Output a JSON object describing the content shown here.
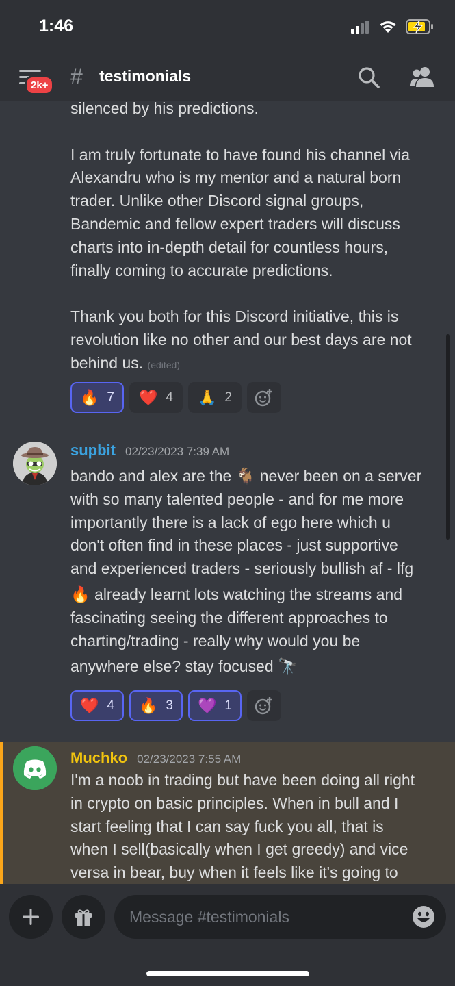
{
  "status_bar": {
    "time": "1:46"
  },
  "header": {
    "badge": "2k+",
    "hash": "#",
    "channel": "testimonials"
  },
  "messages": [
    {
      "continuation_lines": [
        "silenced by his predictions.",
        "",
        "I am truly fortunate to have found his channel via",
        "Alexandru who is my mentor and a natural born",
        "trader. Unlike other Discord signal groups,",
        "Bandemic and fellow expert traders will discuss",
        "charts into in-depth detail for countless hours,",
        "finally coming to accurate predictions.",
        "",
        "Thank you both for this Discord initiative, this is",
        "revolution like no other and our best days are not",
        "behind us."
      ],
      "edited": "(edited)",
      "reactions": [
        {
          "emoji": "🔥",
          "count": "7",
          "me": true
        },
        {
          "emoji": "❤️",
          "count": "4",
          "me": false
        },
        {
          "emoji": "🙏",
          "count": "2",
          "me": false
        }
      ]
    },
    {
      "author": "supbit",
      "author_color": "#3ba3e0",
      "timestamp": "02/23/2023 7:39 AM",
      "lines": [
        "bando and alex are the 🐐 never been on a server",
        "with so many talented people - and for me more",
        "importantly there is a lack of ego here which u",
        "don't often find in these places - just supportive",
        "and experienced traders - seriously bullish af - lfg",
        "🔥 already learnt lots watching the streams and",
        "fascinating seeing the different approaches to",
        "charting/trading - really why would you be",
        "anywhere else? stay focused 🔭"
      ],
      "reactions": [
        {
          "emoji": "❤️",
          "count": "4",
          "me": true
        },
        {
          "emoji": "🔥",
          "count": "3",
          "me": true
        },
        {
          "emoji": "💜",
          "count": "1",
          "me": true
        }
      ]
    },
    {
      "author": "Muchko",
      "author_color": "#f1c40f",
      "timestamp": "02/23/2023 7:55 AM",
      "lines": [
        "I'm a noob in trading but have been doing all right",
        "in crypto on basic principles. When in bull and I",
        "start feeling that I can say fuck you all, that is",
        "when I sell(basically when I get greedy) and vice",
        "versa in bear, buy when it feels like it's going to"
      ]
    }
  ],
  "composer": {
    "placeholder": "Message #testimonials"
  },
  "colors": {
    "accent": "#5865f2",
    "mention_bar": "#faa61a",
    "badge": "#ed4245"
  }
}
